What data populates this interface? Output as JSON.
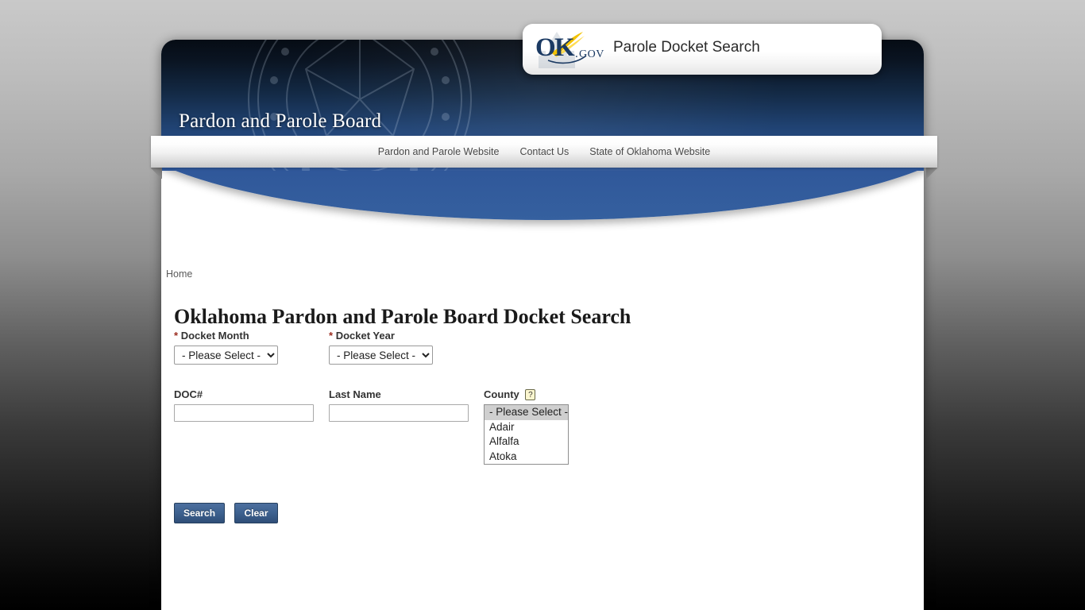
{
  "branding": {
    "badge_logo_alt": "ok-gov-logo",
    "badge_title": "Parole Docket Search",
    "logo_ok": "OK",
    "logo_gov": ".GOV",
    "header_title": "Pardon and Parole Board",
    "accent_navy": "#1f4170",
    "accent_blue": "#30589a",
    "logo_gold": "#f2c200",
    "required_red": "#9b2c1f"
  },
  "nav": {
    "links": [
      {
        "label": "Pardon and Parole Website"
      },
      {
        "label": "Contact Us"
      },
      {
        "label": "State of Oklahoma Website"
      }
    ]
  },
  "breadcrumb": {
    "items": [
      {
        "label": "Home"
      }
    ]
  },
  "page": {
    "title": "Oklahoma Pardon and Parole Board Docket Search"
  },
  "form": {
    "docket_month": {
      "label": "Docket Month",
      "required_marker": "*",
      "value": "- Please Select -",
      "options": [
        "- Please Select -"
      ]
    },
    "docket_year": {
      "label": "Docket Year",
      "required_marker": "*",
      "value": "- Please Select -",
      "options": [
        "- Please Select -"
      ]
    },
    "doc_number": {
      "label": "DOC#",
      "value": "",
      "placeholder": ""
    },
    "last_name": {
      "label": "Last Name",
      "value": "",
      "placeholder": ""
    },
    "county": {
      "label": "County",
      "help_icon": "question-mark-icon",
      "help_label": "?",
      "selected": "- Please Select -",
      "options": [
        {
          "label": "- Please Select -",
          "selected": true
        },
        {
          "label": "Adair",
          "selected": false
        },
        {
          "label": "Alfalfa",
          "selected": false
        },
        {
          "label": "Atoka",
          "selected": false
        }
      ]
    },
    "buttons": {
      "search_label": "Search",
      "clear_label": "Clear"
    }
  }
}
